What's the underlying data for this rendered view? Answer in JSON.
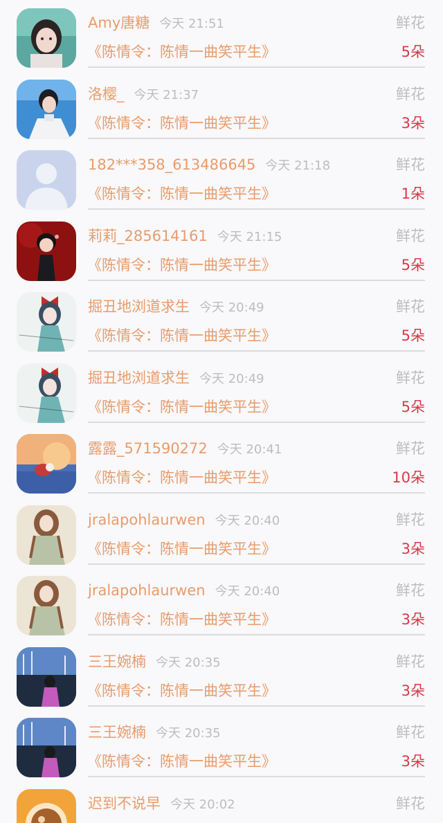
{
  "rows": [
    {
      "user": "Amy唐糖",
      "time": "今天 21:51",
      "gift": "鲜花",
      "work": "《陈情令：陈情一曲笑平生》",
      "count": "5朵",
      "avatar": "photo-girl-avatar"
    },
    {
      "user": "洛樱_",
      "time": "今天 21:37",
      "gift": "鲜花",
      "work": "《陈情令：陈情一曲笑平生》",
      "count": "3朵",
      "avatar": "man-portrait-avatar"
    },
    {
      "user": "182***358_613486645",
      "time": "今天 21:18",
      "gift": "鲜花",
      "work": "《陈情令：陈情一曲笑平生》",
      "count": "1朵",
      "avatar": "default-avatar"
    },
    {
      "user": "莉莉_285614161",
      "time": "今天 21:15",
      "gift": "鲜花",
      "work": "《陈情令：陈情一曲笑平生》",
      "count": "5朵",
      "avatar": "cartoon-boy-avatar"
    },
    {
      "user": "掘丑地浏道求生",
      "time": "今天 20:49",
      "gift": "鲜花",
      "work": "《陈情令：陈情一曲笑平生》",
      "count": "5朵",
      "avatar": "anime-girl-bow-avatar"
    },
    {
      "user": "掘丑地浏道求生",
      "time": "今天 20:49",
      "gift": "鲜花",
      "work": "《陈情令：陈情一曲笑平生》",
      "count": "5朵",
      "avatar": "anime-girl-bow-avatar"
    },
    {
      "user": "露露_571590272",
      "time": "今天 20:41",
      "gift": "鲜花",
      "work": "《陈情令：陈情一曲笑平生》",
      "count": "10朵",
      "avatar": "sunset-illustration-avatar"
    },
    {
      "user": "jralapohlaurwen",
      "time": "今天 20:40",
      "gift": "鲜花",
      "work": "《陈情令：陈情一曲笑平生》",
      "count": "3朵",
      "avatar": "illustrated-girl-avatar"
    },
    {
      "user": "jralapohlaurwen",
      "time": "今天 20:40",
      "gift": "鲜花",
      "work": "《陈情令：陈情一曲笑平生》",
      "count": "3朵",
      "avatar": "illustrated-girl-avatar"
    },
    {
      "user": "三王婉楠",
      "time": "今天 20:35",
      "gift": "鲜花",
      "work": "《陈情令：陈情一曲笑平生》",
      "count": "3朵",
      "avatar": "harbor-photo-avatar"
    },
    {
      "user": "三王婉楠",
      "time": "今天 20:35",
      "gift": "鲜花",
      "work": "《陈情令：陈情一曲笑平生》",
      "count": "3朵",
      "avatar": "harbor-photo-avatar"
    },
    {
      "user": "迟到不说早",
      "time": "今天 20:02",
      "gift": "鲜花",
      "work": "",
      "count": "",
      "avatar": "food-photo-avatar"
    }
  ],
  "colors": {
    "username": "#e89c6c",
    "count": "#d63a4a",
    "muted": "#bdbdbd",
    "background": "#f9f8fa"
  }
}
